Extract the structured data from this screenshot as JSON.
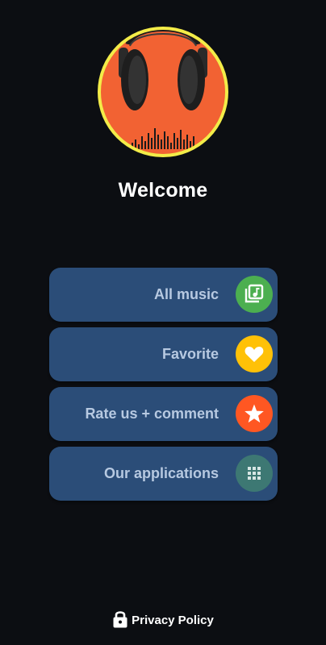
{
  "app": {
    "welcome_text": "Welcome",
    "logo_icon": "headphones-equalizer-logo"
  },
  "menu": {
    "items": [
      {
        "label": "All music",
        "icon": "music-library-icon",
        "color": "#4caf50"
      },
      {
        "label": "Favorite",
        "icon": "heart-icon",
        "color": "#ffc107"
      },
      {
        "label": "Rate us + comment",
        "icon": "star-icon",
        "color": "#ff5722"
      },
      {
        "label": "Our applications",
        "icon": "apps-grid-icon",
        "color": "#3d7873"
      }
    ]
  },
  "footer": {
    "privacy_label": "Privacy Policy",
    "icon": "lock-icon"
  },
  "colors": {
    "background": "#0c0e12",
    "button": "#2b4d78",
    "button_text": "#b7c9e1",
    "logo_ring": "#f3ec48",
    "logo_fill": "#f26233"
  }
}
